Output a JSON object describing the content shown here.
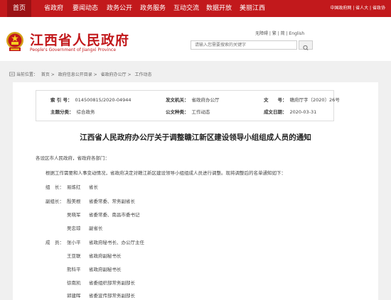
{
  "nav": {
    "items": [
      {
        "label": "首页",
        "active": true
      },
      {
        "label": "省政府"
      },
      {
        "label": "要闻动态"
      },
      {
        "label": "政务公开"
      },
      {
        "label": "政务服务"
      },
      {
        "label": "互动交流"
      },
      {
        "label": "数据开放"
      },
      {
        "label": "美丽江西"
      }
    ],
    "links": "中国政府网 | 省人大 | 省政协"
  },
  "header": {
    "title": "江西省人民政府",
    "subtitle": "People's Government of Jiangxi Province",
    "util_links": "无障碍 | 繁 | 简 | English",
    "search_placeholder": "请输入您需要搜索的关键字",
    "emblem_icon": "national-emblem-icon",
    "search_icon": "search-icon",
    "brand_color": "#c2191c"
  },
  "breadcrumb": {
    "prefix": "当前位置：",
    "items": [
      "首页",
      "政府信息公开目录",
      "省政府办公厅",
      "工作动态"
    ]
  },
  "meta": {
    "index_label": "索 引 号：",
    "index_value": "014500815/2020-04944",
    "org_label": "发文机关：",
    "org_value": "省政府办公厅",
    "docno_label": "文　　号：",
    "docno_value": "赣府厅字〔2020〕26号",
    "topic_label": "主题分类：",
    "topic_value": "综合政务",
    "type_label": "公文种类：",
    "type_value": "工作动态",
    "date_label": "成文日期：",
    "date_value": "2020-03-31"
  },
  "doc": {
    "title": "江西省人民政府办公厅关于调整赣江新区建设领导小组组成人员的通知",
    "addressee": "各设区市人民政府，省政府各部门：",
    "intro": "根据工作需要和人事变动情况，省政府决定对赣江新区建设领导小组组成人员进行调整。现将调整后的名单通知如下：",
    "leader_label": "组　长：",
    "leader_name": "易炼红",
    "leader_pos": "省长",
    "deputy_label": "副组长：",
    "deputies": [
      {
        "name": "殷美根",
        "pos": "省委常委、常务副省长"
      },
      {
        "name": "吴晓军",
        "pos": "省委常委、南昌市委书记"
      },
      {
        "name": "吴忠琼",
        "pos": "副省长"
      }
    ],
    "member_label": "成　员：",
    "members": [
      {
        "name": "张小平",
        "pos": "省政府秘书长、办公厅主任"
      },
      {
        "name": "王亚联",
        "pos": "省政府副秘书长"
      },
      {
        "name": "熊科平",
        "pos": "省政府副秘书长"
      },
      {
        "name": "徐南凯",
        "pos": "省委组织部常务副部长"
      },
      {
        "name": "郭建晖",
        "pos": "省委宣传部常务副部长"
      }
    ]
  }
}
